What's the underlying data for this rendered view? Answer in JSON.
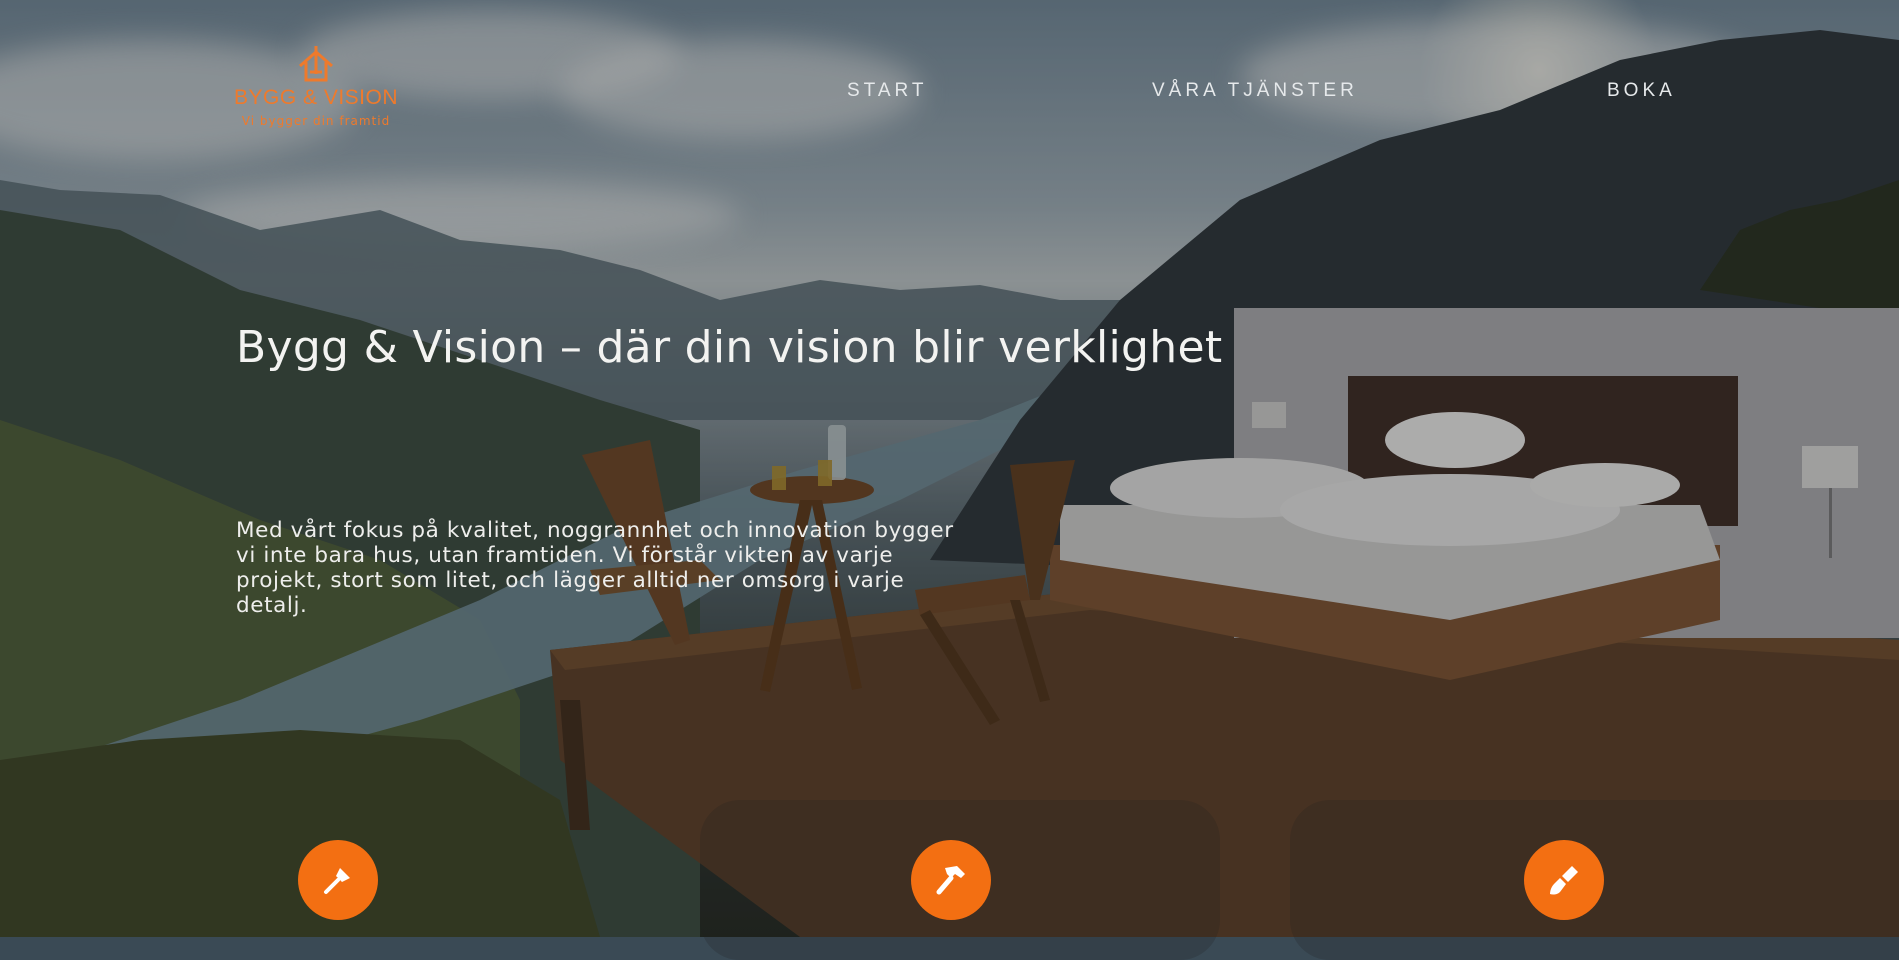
{
  "header": {
    "brand_name": "BYGG & VISION",
    "brand_tagline": "Vi bygger din framtid",
    "nav": [
      {
        "label": "START"
      },
      {
        "label": "VÅRA TJÄNSTER"
      },
      {
        "label": "BOKA"
      }
    ]
  },
  "hero": {
    "title": "Bygg & Vision – där din vision blir verklighet",
    "description": "Med vårt fokus på kvalitet, noggrannhet och innovation bygger vi inte bara hus, utan framtiden. Vi förstår vikten av varje projekt, stort som litet, och lägger alltid ner omsorg i varje detalj."
  },
  "services": [
    {
      "icon": "trowel-icon"
    },
    {
      "icon": "hammer-icon"
    },
    {
      "icon": "paint-brush-icon"
    }
  ],
  "colors": {
    "accent": "#f36f12",
    "brand": "#ee7a2c",
    "nav_text": "#e6e9eb",
    "hero_text": "#f3f3f1"
  }
}
